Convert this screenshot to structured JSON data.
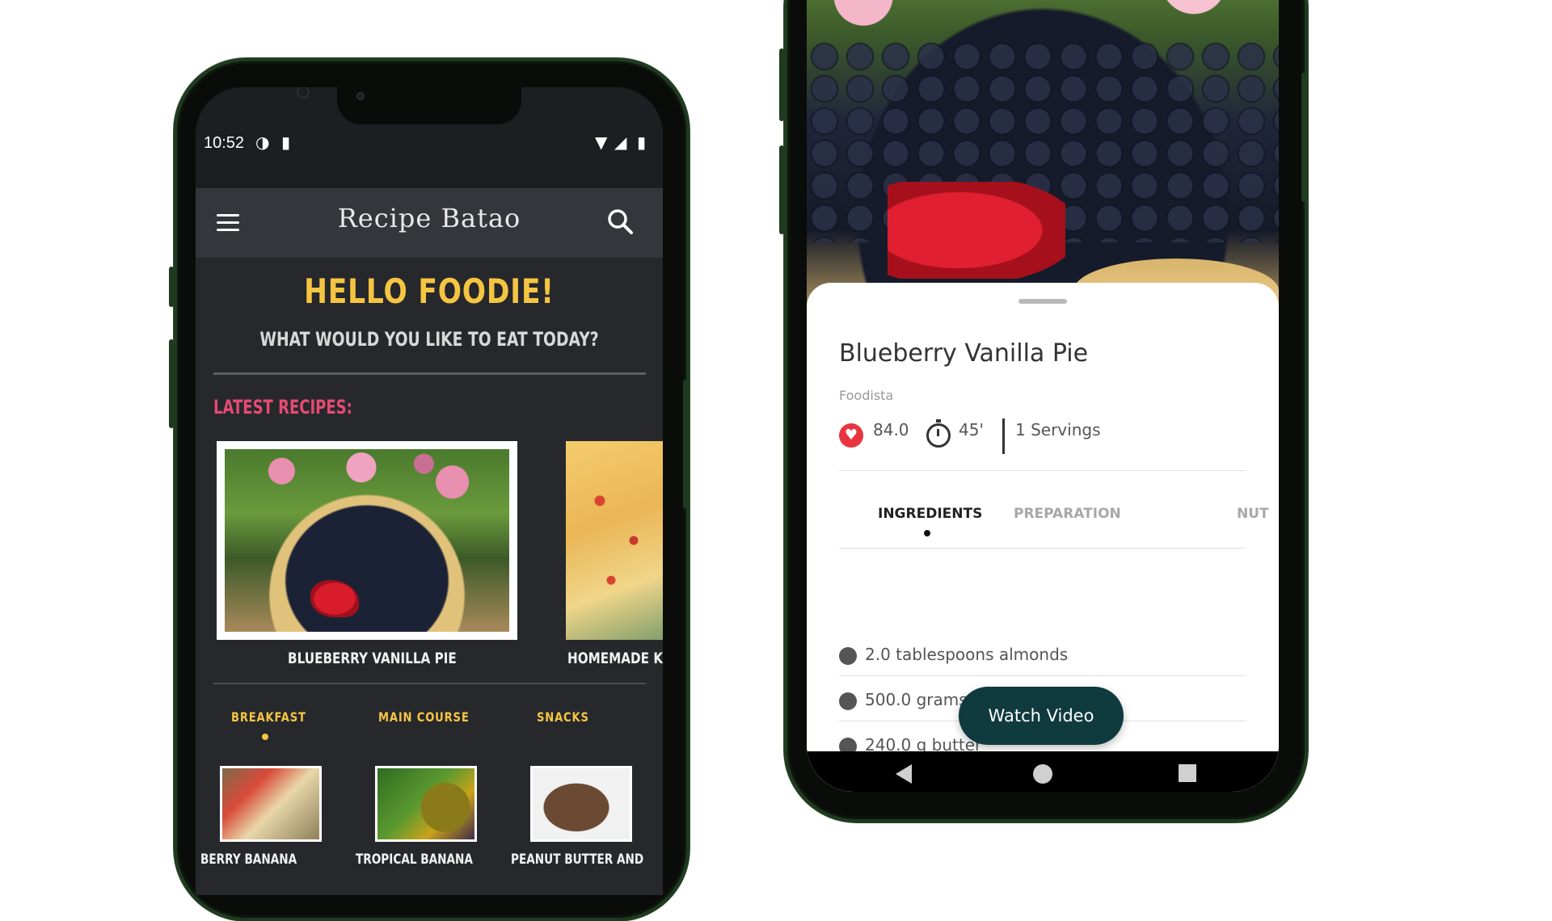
{
  "left_phone": {
    "status": {
      "time": "10:52",
      "icons": [
        "data-saver-icon",
        "sd-card-icon",
        "wifi-icon",
        "signal-icon",
        "battery-icon"
      ]
    },
    "app_bar": {
      "title": "Recipe Batao",
      "menu_icon": "hamburger-menu-icon",
      "search_icon": "search-icon"
    },
    "greeting": "HELLO FOODIE!",
    "prompt": "WHAT WOULD YOU LIKE TO EAT TODAY?",
    "latest_heading": "LATEST RECIPES:",
    "latest_recipes": [
      {
        "label": "BLUEBERRY VANILLA PIE"
      },
      {
        "label": "HOMEMADE K"
      }
    ],
    "tabs": [
      {
        "label": "BREAKFAST",
        "selected": true
      },
      {
        "label": "MAIN COURSE",
        "selected": false
      },
      {
        "label": "SNACKS",
        "selected": false
      }
    ],
    "category_items": [
      {
        "label": "BERRY BANANA"
      },
      {
        "label": "TROPICAL BANANA"
      },
      {
        "label": "PEANUT BUTTER AND"
      }
    ],
    "colors": {
      "accent": "#f5c542",
      "heading": "#e64a72",
      "background": "#26282c"
    }
  },
  "right_phone": {
    "recipe": {
      "title": "Blueberry Vanilla Pie",
      "source": "Foodista",
      "score": "84.0",
      "time": "45'",
      "servings": "1 Servings"
    },
    "tabs": [
      {
        "label": "INGREDIENTS",
        "selected": true
      },
      {
        "label": "PREPARATION",
        "selected": false
      },
      {
        "label": "NUT",
        "selected": false
      }
    ],
    "ingredients": [
      "2.0 tablespoons almonds",
      "500.0 grams",
      "240.0 g butter"
    ],
    "fab_label": "Watch Video",
    "nav_icons": [
      "back-icon",
      "home-icon",
      "recents-icon"
    ],
    "colors": {
      "fab": "#0f3a3e",
      "heart": "#e8353f"
    }
  }
}
